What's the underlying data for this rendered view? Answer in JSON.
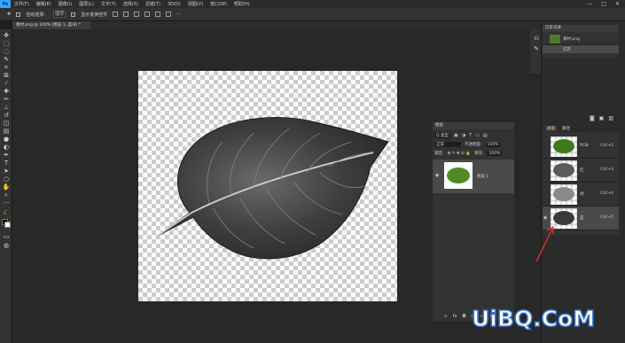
{
  "menubar": {
    "logo": "Ps",
    "items": [
      "文件(F)",
      "编辑(E)",
      "图像(I)",
      "图层(L)",
      "文字(Y)",
      "选择(S)",
      "滤镜(T)",
      "3D(D)",
      "视图(V)",
      "窗口(W)",
      "帮助(H)"
    ],
    "window_controls": [
      "—",
      "□",
      "✕"
    ]
  },
  "options": {
    "auto_select_label": "自动选择：",
    "auto_select_value": "图层",
    "transform_label": "显示变换控件"
  },
  "document": {
    "tab_title": "素材.png @ 100% (图层 1, 蓝/8) *"
  },
  "history": {
    "tab_label": "历史记录",
    "snapshot_name": "素材.png",
    "step": "打开"
  },
  "channels": {
    "tabs": [
      "通道",
      "路径"
    ],
    "rows": [
      {
        "name": "RGB",
        "key": "Ctrl+2",
        "selected": false,
        "style": "rgb"
      },
      {
        "name": "红",
        "key": "Ctrl+3",
        "selected": false,
        "style": "red"
      },
      {
        "name": "绿",
        "key": "Ctrl+4",
        "selected": false,
        "style": "green"
      },
      {
        "name": "蓝",
        "key": "Ctrl+5",
        "selected": true,
        "style": "blue"
      }
    ]
  },
  "layers": {
    "tab_label": "图层",
    "filter_label": "Q 类型",
    "blend_mode": "正常",
    "opacity_label": "不透明度:",
    "opacity_value": "100%",
    "lock_label": "锁定:",
    "fill_label": "填充:",
    "fill_value": "100%",
    "layer_name": "图层 1"
  },
  "watermark": "UiBQ.CoM",
  "colors": {
    "accent": "#31a8ff",
    "annotation_arrow": "#e8312a"
  }
}
